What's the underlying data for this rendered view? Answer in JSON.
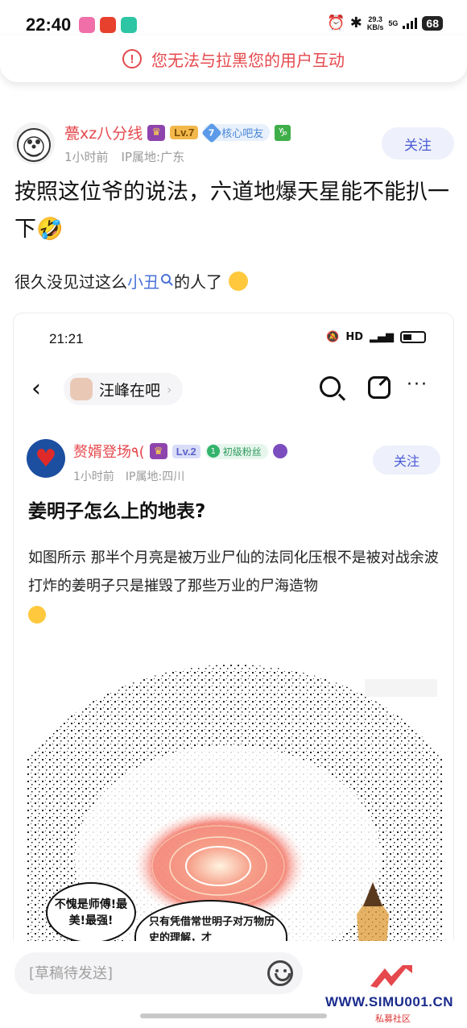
{
  "status_bar": {
    "time": "22:40",
    "net_speed_value": "29.3",
    "net_speed_unit": "KB/s",
    "network": "5G",
    "battery": "68"
  },
  "banner": {
    "text": "您无法与拉黑您的用户互动",
    "color": "#e5484d"
  },
  "post": {
    "username": "甍xz八分线",
    "level": "Lv.7",
    "member_number": "7",
    "member_label": "核心吧友",
    "time": "1小时前",
    "location": "IP属地:广东",
    "follow_label": "关注",
    "title": "按照这位爷的说法，六道地爆天星能不能扒一下🤣",
    "body_prefix": "很久没见过这么",
    "body_link": "小丑",
    "body_suffix": "的人了"
  },
  "embedded": {
    "status_time": "21:21",
    "forum_name": "汪峰在吧",
    "username": "赘婿登场٩(",
    "level": "Lv.2",
    "fan_label": "初级粉丝",
    "time": "1小时前",
    "location": "IP属地:四川",
    "follow_label": "关注",
    "title": "姜明子怎么上的地表?",
    "body": "如图所示 那半个月亮是被万业尸仙的法同化压根不是被对战余波打炸的姜明子只是摧毁了那些万业的尸海造物",
    "bubble1": "不愧是师傅!最美!最强!",
    "bubble2": "只有凭借常世明子对万物历史的理解，才"
  },
  "bottom": {
    "draft_placeholder": "[草稿待发送]"
  },
  "watermark": {
    "text": "WWW.SIMU001.CN",
    "sub": "私募社区"
  },
  "colors": {
    "accent": "#4a5cd6",
    "username_red": "#e5484d",
    "link_blue": "#4a72d8"
  }
}
